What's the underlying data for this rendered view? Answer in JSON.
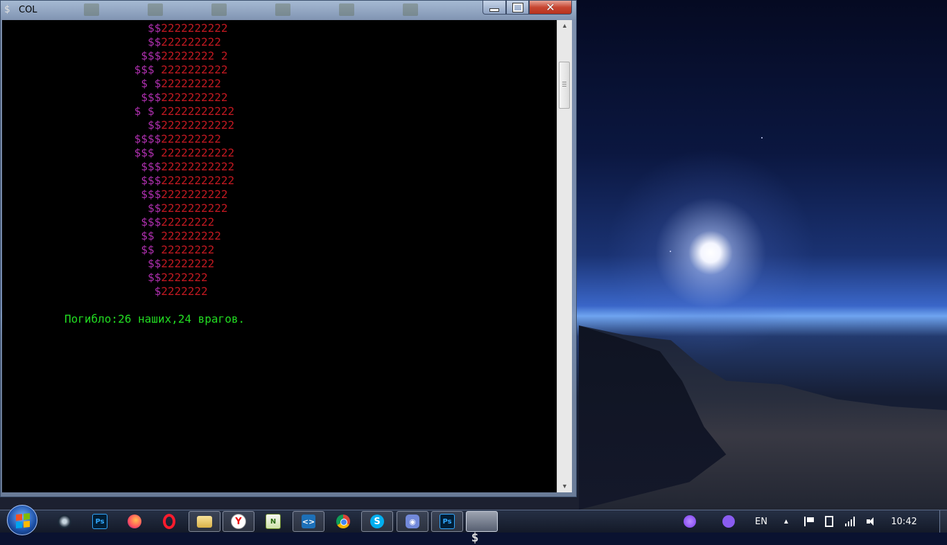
{
  "window": {
    "title": "COL",
    "icon": "dollar-console-icon",
    "console_lines": [
      {
        "indent": 23,
        "dollars": "$$",
        "digits": "2222222222"
      },
      {
        "indent": 23,
        "dollars": "$$",
        "digits": "222222222"
      },
      {
        "indent": 22,
        "dollars": "$$$",
        "digits": "22222222 2"
      },
      {
        "indent": 21,
        "dollars": "$$$ ",
        "digits": "2222222222"
      },
      {
        "indent": 22,
        "dollars": "$ $",
        "digits": "222222222"
      },
      {
        "indent": 22,
        "dollars": "$$$",
        "digits": "2222222222"
      },
      {
        "indent": 21,
        "dollars": "$ $ ",
        "digits": "22222222222"
      },
      {
        "indent": 23,
        "dollars": "$$",
        "digits": "22222222222"
      },
      {
        "indent": 21,
        "dollars": "$$$$",
        "digits": "222222222"
      },
      {
        "indent": 21,
        "dollars": "$$$ ",
        "digits": "22222222222"
      },
      {
        "indent": 22,
        "dollars": "$$$",
        "digits": "22222222222"
      },
      {
        "indent": 22,
        "dollars": "$$$",
        "digits": "22222222222"
      },
      {
        "indent": 22,
        "dollars": "$$$",
        "digits": "2222222222"
      },
      {
        "indent": 23,
        "dollars": "$$",
        "digits": "2222222222"
      },
      {
        "indent": 22,
        "dollars": "$$$",
        "digits": "22222222"
      },
      {
        "indent": 22,
        "dollars": "$$ ",
        "digits": "222222222"
      },
      {
        "indent": 22,
        "dollars": "$$ ",
        "digits": "22222222"
      },
      {
        "indent": 23,
        "dollars": "$$",
        "digits": "22222222"
      },
      {
        "indent": 23,
        "dollars": "$$",
        "digits": "2222222"
      },
      {
        "indent": 24,
        "dollars": "$",
        "digits": "2222222"
      }
    ],
    "status_line": "Погибло:26 наших,24 врагов.",
    "colors": {
      "dollar": "#b030b0",
      "digit": "#c01820",
      "status": "#22dd22",
      "background": "#000000"
    }
  },
  "taskbar": {
    "buttons": [
      {
        "name": "taskbar-steam",
        "icon": "steam-icon",
        "glyph": ""
      },
      {
        "name": "taskbar-photoshop",
        "icon": "photoshop-icon",
        "glyph": "Ps"
      },
      {
        "name": "taskbar-firefox",
        "icon": "firefox-icon",
        "glyph": ""
      },
      {
        "name": "taskbar-opera",
        "icon": "opera-icon",
        "glyph": ""
      },
      {
        "name": "taskbar-explorer",
        "icon": "folder-icon",
        "glyph": ""
      },
      {
        "name": "taskbar-yandex",
        "icon": "yandex-browser-icon",
        "glyph": "Y"
      },
      {
        "name": "taskbar-notepad",
        "icon": "notepad-plus-icon",
        "glyph": "N"
      },
      {
        "name": "taskbar-vscode",
        "icon": "vscode-icon",
        "glyph": "<>"
      },
      {
        "name": "taskbar-chrome",
        "icon": "chrome-icon",
        "glyph": ""
      },
      {
        "name": "taskbar-skype",
        "icon": "skype-icon",
        "glyph": "S"
      },
      {
        "name": "taskbar-discord",
        "icon": "discord-icon",
        "glyph": "◉"
      },
      {
        "name": "taskbar-photoshop-2",
        "icon": "photoshop-icon",
        "glyph": "Ps"
      },
      {
        "name": "taskbar-console",
        "icon": "dollar-console-icon",
        "glyph": "$"
      }
    ],
    "tray": {
      "language": "EN",
      "time": "10:42"
    }
  }
}
